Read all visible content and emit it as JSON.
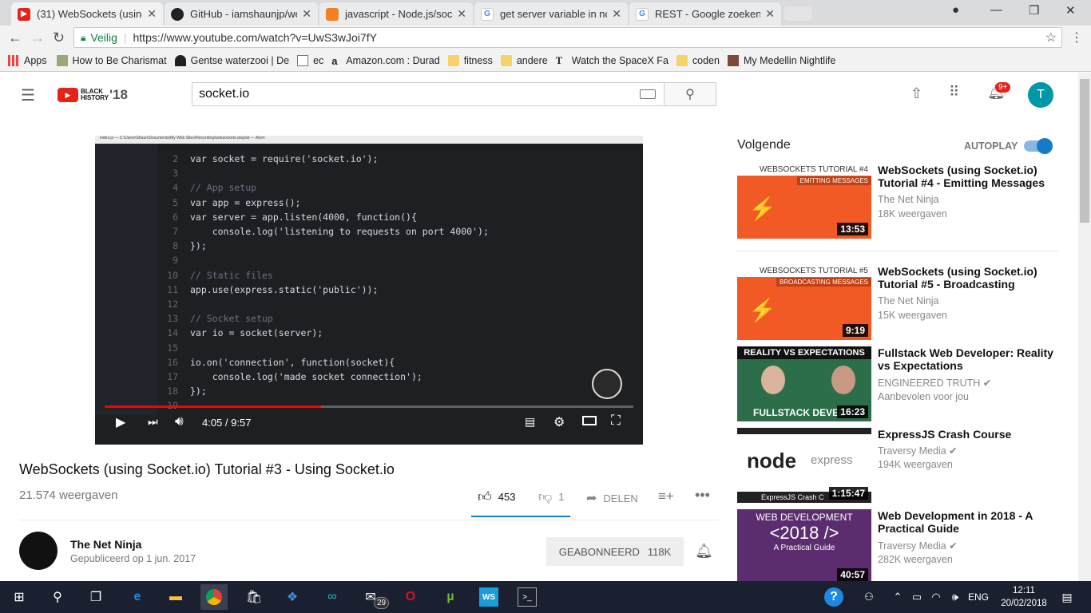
{
  "browser": {
    "tabs": [
      {
        "title": "(31) WebSockets (using S",
        "icon": "youtube-icon"
      },
      {
        "title": "GitHub - iamshaunjp/we",
        "icon": "github-icon"
      },
      {
        "title": "javascript - Node.js/sock",
        "icon": "stackoverflow-icon"
      },
      {
        "title": "get server variable in noc",
        "icon": "google-icon"
      },
      {
        "title": "REST - Google zoeken",
        "icon": "google-icon"
      }
    ],
    "secure_label": "Veilig",
    "url": "https://www.youtube.com/watch?v=UwS3wJoi7fY",
    "bookmarks": [
      {
        "label": "Apps"
      },
      {
        "label": "How to Be Charismat"
      },
      {
        "label": "Gentse waterzooi | De"
      },
      {
        "label": "ec"
      },
      {
        "label": "Amazon.com : Durad"
      },
      {
        "label": "fitness"
      },
      {
        "label": "andere"
      },
      {
        "label": "Watch the SpaceX Fa"
      },
      {
        "label": "coden"
      },
      {
        "label": "My Medellin Nightlife"
      }
    ]
  },
  "youtube": {
    "logo_text": "BLACK HISTORY",
    "logo_year": "'18",
    "search_value": "socket.io",
    "notif_count": "9+",
    "avatar_letter": "T"
  },
  "player": {
    "time": "4:05 / 9:57",
    "progress": 0.41,
    "editor_title": "index.js — C:\\Users\\Shaun\\Documents\\My Web Sites\\Recording\\websockets-playlist — Atom",
    "code_lines": [
      {
        "n": "2",
        "text": "var socket = require('socket.io');"
      },
      {
        "n": "3",
        "text": ""
      },
      {
        "n": "4",
        "text": "// App setup"
      },
      {
        "n": "5",
        "text": "var app = express();"
      },
      {
        "n": "6",
        "text": "var server = app.listen(4000, function(){"
      },
      {
        "n": "7",
        "text": "    console.log('listening to requests on port 4000');"
      },
      {
        "n": "8",
        "text": "});"
      },
      {
        "n": "9",
        "text": ""
      },
      {
        "n": "10",
        "text": "// Static files"
      },
      {
        "n": "11",
        "text": "app.use(express.static('public'));"
      },
      {
        "n": "12",
        "text": ""
      },
      {
        "n": "13",
        "text": "// Socket setup"
      },
      {
        "n": "14",
        "text": "var io = socket(server);"
      },
      {
        "n": "15",
        "text": ""
      },
      {
        "n": "16",
        "text": "io.on('connection', function(socket){"
      },
      {
        "n": "17",
        "text": "    console.log('made socket connection');"
      },
      {
        "n": "18",
        "text": "});"
      },
      {
        "n": "19",
        "text": ""
      }
    ]
  },
  "video": {
    "title": "WebSockets (using Socket.io) Tutorial #3 - Using Socket.io",
    "views": "21.574 weergaven",
    "likes": "453",
    "dislikes": "1",
    "share_label": "DELEN",
    "channel": "The Net Ninja",
    "published": "Gepubliceerd op 1 jun. 2017",
    "subscribe_label": "GEABONNEERD",
    "subscribers": "118K"
  },
  "sidebar": {
    "up_next": "Volgende",
    "autoplay": "AUTOPLAY",
    "items": [
      {
        "title": "WebSockets (using Socket.io) Tutorial #4 - Emitting Messages",
        "channel": "The Net Ninja",
        "views": "18K weergaven",
        "duration": "13:53",
        "thumb_title": "WEBSOCKETS TUTORIAL #4",
        "thumb_sub": "EMITTING MESSAGES"
      },
      {
        "title": "WebSockets (using Socket.io) Tutorial #5 - Broadcasting",
        "channel": "The Net Ninja",
        "views": "15K weergaven",
        "duration": "9:19",
        "thumb_title": "WEBSOCKETS TUTORIAL #5",
        "thumb_sub": "BROADCASTING MESSAGES"
      },
      {
        "title": "Fullstack Web Developer: Reality vs Expectations",
        "channel": "ENGINEERED TRUTH",
        "views": "Aanbevolen voor jou",
        "duration": "16:23",
        "thumb_title": "REALITY VS EXPECTATIONS",
        "thumb_sub": "FULLSTACK DEVEL"
      },
      {
        "title": "ExpressJS Crash Course",
        "channel": "Traversy Media",
        "views": "194K weergaven",
        "duration": "1:15:47",
        "thumb_title": "node",
        "thumb_sub": "express",
        "thumb_foot": "ExpressJS Crash C"
      },
      {
        "title": "Web Development in 2018 - A Practical Guide",
        "channel": "Traversy Media",
        "views": "282K weergaven",
        "duration": "40:57",
        "thumb_title": "WEB DEVELOPMENT",
        "thumb_sub": "<2018 />",
        "thumb_foot": "A Practical Guide"
      }
    ]
  },
  "taskbar": {
    "time": "12:11",
    "date": "20/02/2018",
    "lang": "ENG",
    "mail_badge": "29"
  }
}
